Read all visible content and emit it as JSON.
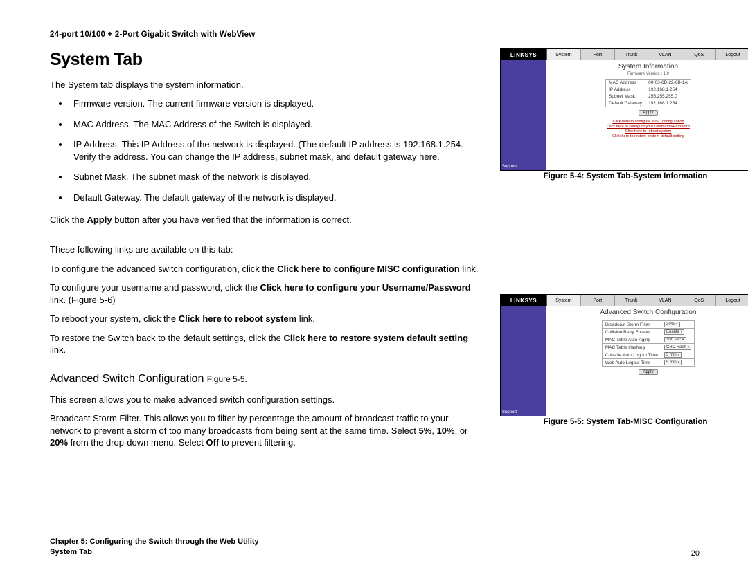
{
  "header": "24-port 10/100 + 2-Port Gigabit Switch with WebView",
  "title": "System Tab",
  "intro": "The System tab displays the system information.",
  "bullets": [
    "Firmware version. The current firmware version is displayed.",
    "MAC Address. The MAC Address of the Switch is displayed.",
    "IP Address. This IP Address of the network is displayed. (The default IP address is 192.168.1.254. Verify the address. You can change the IP address, subnet mask, and default gateway here.",
    "Subnet Mask. The subnet mask of the network is displayed.",
    "Default Gateway. The default gateway of the network is displayed."
  ],
  "apply_line": {
    "pre": "Click the ",
    "bold": "Apply",
    "post": " button after you have verified that the information is correct."
  },
  "links_intro": "These following links are available on this tab:",
  "link_lines": [
    {
      "pre": "To configure the advanced switch configuration, click the ",
      "bold": "Click here to configure MISC configuration",
      "post": " link."
    },
    {
      "pre": "To configure your username and password, click the ",
      "bold": "Click here to configure your Username/Password",
      "post": " link. (Figure 5-6)"
    },
    {
      "pre": "To reboot your system, click the ",
      "bold": "Click here to reboot system",
      "post": " link."
    },
    {
      "pre": "To restore the Switch back to the default settings, click the ",
      "bold": "Click here to restore system default setting",
      "post": " link."
    }
  ],
  "subheading": {
    "main": "Advanced Switch Configuration ",
    "fig": "Figure 5-5."
  },
  "adv_intro": "This screen allows you to make advanced switch configuration settings.",
  "adv_para": {
    "pre": "Broadcast Storm Filter. This allows you to filter by percentage the amount of broadcast traffic to your network to prevent a storm of too many broadcasts from being sent at the same time. Select ",
    "b1": "5%",
    "m1": ", ",
    "b2": "10%",
    "m2": ", or ",
    "b3": "20%",
    "m3": " from the drop-down menu. Select ",
    "b4": "Off",
    "post": " to prevent filtering."
  },
  "fig1": {
    "caption": "Figure 5-4: System Tab-System Information",
    "logo": "LINKSYS",
    "tabs": [
      "System",
      "Port",
      "Trunk",
      "VLAN",
      "QoS",
      "Logout"
    ],
    "title": "System Information",
    "fw": "Firmware Version : 1.0",
    "rows": [
      {
        "k": "MAC Address",
        "v": "00-03-6D-22-6B-1A"
      },
      {
        "k": "IP Address",
        "v": "192.168.1.254"
      },
      {
        "k": "Subnet Mask",
        "v": "255.255.255.0"
      },
      {
        "k": "Default Gateway",
        "v": "192.168.1.254"
      }
    ],
    "apply": "Apply",
    "links": [
      "Click here to configure MISC configuration",
      "Click here to configure your Username/Password",
      "Click here to reboot system",
      "Click here to restore system default setting"
    ],
    "sidebar_bottom": "Support"
  },
  "fig2": {
    "caption": "Figure 5-5: System Tab-MISC Configuration",
    "logo": "LINKSYS",
    "tabs": [
      "System",
      "Port",
      "Trunk",
      "VLAN",
      "QoS",
      "Logout"
    ],
    "title": "Advanced Switch Configuration",
    "rows": [
      {
        "k": "Broadcast Storm Filter",
        "v": "20%"
      },
      {
        "k": "Collision Retry Forever",
        "v": "Enable"
      },
      {
        "k": "MAC Table Auto-Aging",
        "v": "300 sec"
      },
      {
        "k": "MAC Table Hashing",
        "v": "CRC Hash"
      },
      {
        "k": "Console Auto Logout Time",
        "v": "5 min"
      },
      {
        "k": "Web Auto Logout Time",
        "v": "5 min"
      }
    ],
    "apply": "Apply",
    "sidebar_bottom": "Support"
  },
  "footer": {
    "chapter": "Chapter 5: Configuring the Switch through the Web Utility",
    "section": "System Tab",
    "page": "20"
  }
}
